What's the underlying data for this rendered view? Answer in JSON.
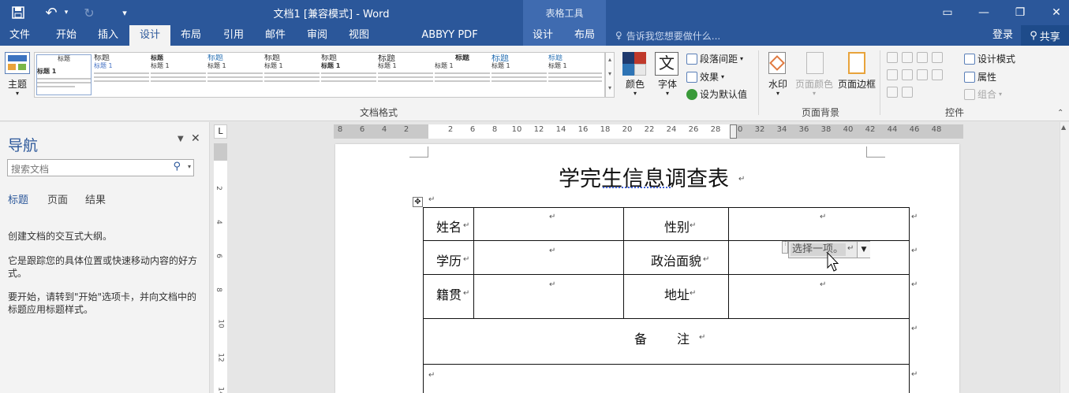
{
  "titlebar": {
    "title": "文档1 [兼容模式] - Word",
    "table_tools": "表格工具",
    "qat": {
      "undo_symbol": "↶",
      "redo_symbol": "↻",
      "customize_symbol": "▾"
    },
    "controls": {
      "ribbon_display": "▭",
      "minimize": "—",
      "restore": "❐",
      "close": "✕"
    }
  },
  "tabs": {
    "file": "文件",
    "home": "开始",
    "insert": "插入",
    "design": "设计",
    "layout": "布局",
    "references": "引用",
    "mailings": "邮件",
    "review": "审阅",
    "view": "视图",
    "abbyy": "ABBYY PDF Transformer+",
    "table_design": "设计",
    "table_layout": "布局",
    "tell_me": "告诉我您想要做什么...",
    "login": "登录",
    "share": "共享"
  },
  "ribbon": {
    "theme": "主题",
    "doc_format_label": "文档格式",
    "colors": "颜色",
    "fonts": "字体",
    "paragraph_spacing": "段落间距",
    "effects": "效果",
    "set_default": "设为默认值",
    "watermark": "水印",
    "page_color": "页面颜色",
    "page_borders": "页面边框",
    "page_background_label": "页面背景",
    "design_mode": "设计模式",
    "properties": "属性",
    "group": "组合",
    "controls_label": "控件",
    "font_glyph": "文",
    "style_thumbs": [
      {
        "head": "标题",
        "sub": "标题 1"
      },
      {
        "head": "标题",
        "sub": "标题 1"
      },
      {
        "head": "标题",
        "sub": "标题 1"
      },
      {
        "head": "标题",
        "sub": "标题 1"
      },
      {
        "head": "标题",
        "sub": "标题 1"
      },
      {
        "head": "标题",
        "sub": "标题 1"
      },
      {
        "head": "标题",
        "sub": "标题 1"
      },
      {
        "head": "标题",
        "sub": "标题 1"
      },
      {
        "head": "标题",
        "sub": "标题 1"
      },
      {
        "head": "标题",
        "sub": "标题 1"
      }
    ]
  },
  "nav": {
    "title": "导航",
    "search_placeholder": "搜索文档",
    "tabs": [
      "标题",
      "页面",
      "结果"
    ],
    "para1": "创建文档的交互式大纲。",
    "para2": "它是跟踪您的具体位置或快速移动内容的好方式。",
    "para3": "要开始，请转到\"开始\"选项卡，并向文档中的标题应用标题样式。"
  },
  "ruler": {
    "ticks": [
      "8",
      "6",
      "4",
      "2",
      "2",
      "6",
      "8",
      "10",
      "12",
      "14",
      "16",
      "18",
      "20",
      "22",
      "24",
      "26",
      "28",
      "30",
      "32",
      "34",
      "36",
      "38",
      "40",
      "42",
      "44",
      "46",
      "48"
    ],
    "vticks": [
      "2",
      "4",
      "6",
      "8",
      "10",
      "12",
      "14"
    ],
    "corner": "L"
  },
  "document": {
    "title": "学完生信息调查表",
    "cells": {
      "name": "姓名",
      "gender": "性别",
      "education": "学历",
      "political": "政治面貌",
      "hometown": "籍贯",
      "address": "地址",
      "remarks": "备　　注"
    },
    "dropdown_value": "选择一项。",
    "para_mark": "↵"
  }
}
